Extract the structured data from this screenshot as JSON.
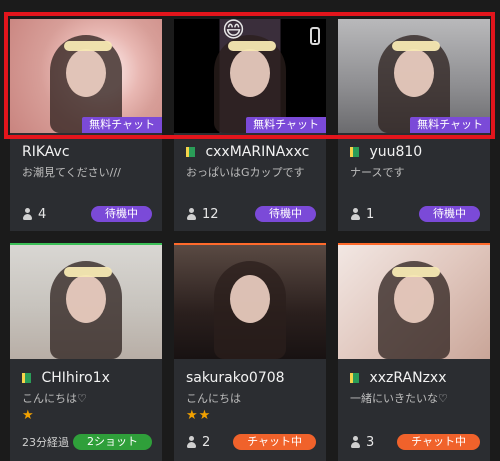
{
  "cards": [
    {
      "name": "RIKAvc",
      "beginner": false,
      "message": "お潮見てください///",
      "tag": "無料チャット",
      "viewers": "4",
      "status": "待機中"
    },
    {
      "name": "cxxMARINAxxc",
      "beginner": true,
      "message": "おっぱいはGカップです",
      "tag": "無料チャット",
      "viewers": "12",
      "status": "待機中",
      "badges": [
        "smiley-emoji",
        "phone-icon"
      ]
    },
    {
      "name": "yuu810",
      "beginner": true,
      "message": "ナースです",
      "tag": "無料チャット",
      "viewers": "1",
      "status": "待機中"
    },
    {
      "name": "CHIhiro1x",
      "beginner": true,
      "message": "こんにちは♡",
      "stars": "★",
      "elapsed": "23分経過",
      "status": "2ショット"
    },
    {
      "name": "sakurako0708",
      "beginner": false,
      "message": "こんにちは",
      "stars": "★★",
      "viewers": "2",
      "status": "チャット中"
    },
    {
      "name": "xxzRANzxx",
      "beginner": true,
      "message": "一緒にいきたいな♡",
      "viewers": "3",
      "status": "チャット中"
    }
  ],
  "colors": {
    "background": "#1b1b1b",
    "card": "#2b2d31",
    "free_tag": "#7b4ad8",
    "status_waiting": "#7b4ad8",
    "status_two_shot": "#2f9f3a",
    "status_chatting": "#f0622b",
    "highlight_border": "#e3151c"
  }
}
